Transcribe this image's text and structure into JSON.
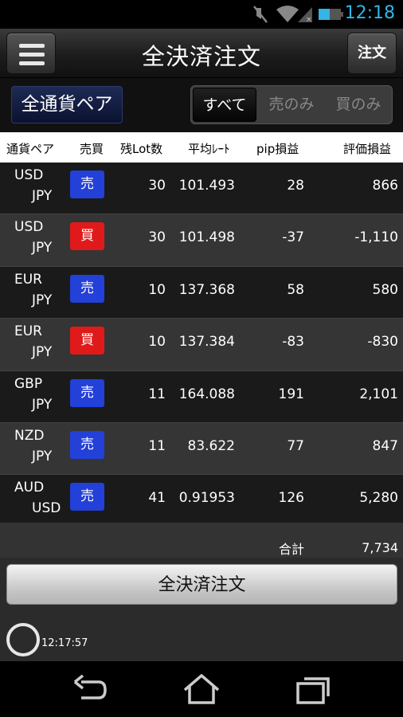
{
  "status_bar": {
    "time": "12:18",
    "icons": [
      "mute-icon",
      "wifi-icon",
      "signal-icon",
      "battery-icon"
    ]
  },
  "header": {
    "title": "全決済注文",
    "order_button": "注文",
    "menu_icon": "hamburger-menu-icon"
  },
  "filter": {
    "pair_button": "全通貨ペア",
    "segments": [
      "すべて",
      "売のみ",
      "買のみ"
    ],
    "selected": "すべて"
  },
  "table": {
    "headers": [
      "通貨ペア",
      "売買",
      "残Lot数",
      "平均ﾚｰﾄ",
      "pip損益",
      "評価損益"
    ],
    "rows": [
      {
        "ccy1": "USD",
        "ccy2": "JPY",
        "side": "売",
        "lot": "30",
        "rate": "101.493",
        "pip": "28",
        "pnl": "866"
      },
      {
        "ccy1": "USD",
        "ccy2": "JPY",
        "side": "買",
        "lot": "30",
        "rate": "101.498",
        "pip": "-37",
        "pnl": "-1,110"
      },
      {
        "ccy1": "EUR",
        "ccy2": "JPY",
        "side": "売",
        "lot": "10",
        "rate": "137.368",
        "pip": "58",
        "pnl": "580"
      },
      {
        "ccy1": "EUR",
        "ccy2": "JPY",
        "side": "買",
        "lot": "10",
        "rate": "137.384",
        "pip": "-83",
        "pnl": "-830"
      },
      {
        "ccy1": "GBP",
        "ccy2": "JPY",
        "side": "売",
        "lot": "11",
        "rate": "164.088",
        "pip": "191",
        "pnl": "2,101"
      },
      {
        "ccy1": "NZD",
        "ccy2": "JPY",
        "side": "売",
        "lot": "11",
        "rate": "83.622",
        "pip": "77",
        "pnl": "847"
      },
      {
        "ccy1": "AUD",
        "ccy2": "USD",
        "side": "売",
        "lot": "41",
        "rate": "0.91953",
        "pip": "126",
        "pnl": "5,280"
      }
    ],
    "total_label": "合計",
    "total_value": "7,734"
  },
  "actions": {
    "close_all_button": "全決済注文"
  },
  "footer": {
    "updated_time": "12:17:57"
  },
  "colors": {
    "sell_badge": "#2340d8",
    "buy_badge": "#e01a1a",
    "status_time": "#33b5e5"
  },
  "navbar": {
    "icons": [
      "back-icon",
      "home-icon",
      "recent-apps-icon"
    ]
  }
}
